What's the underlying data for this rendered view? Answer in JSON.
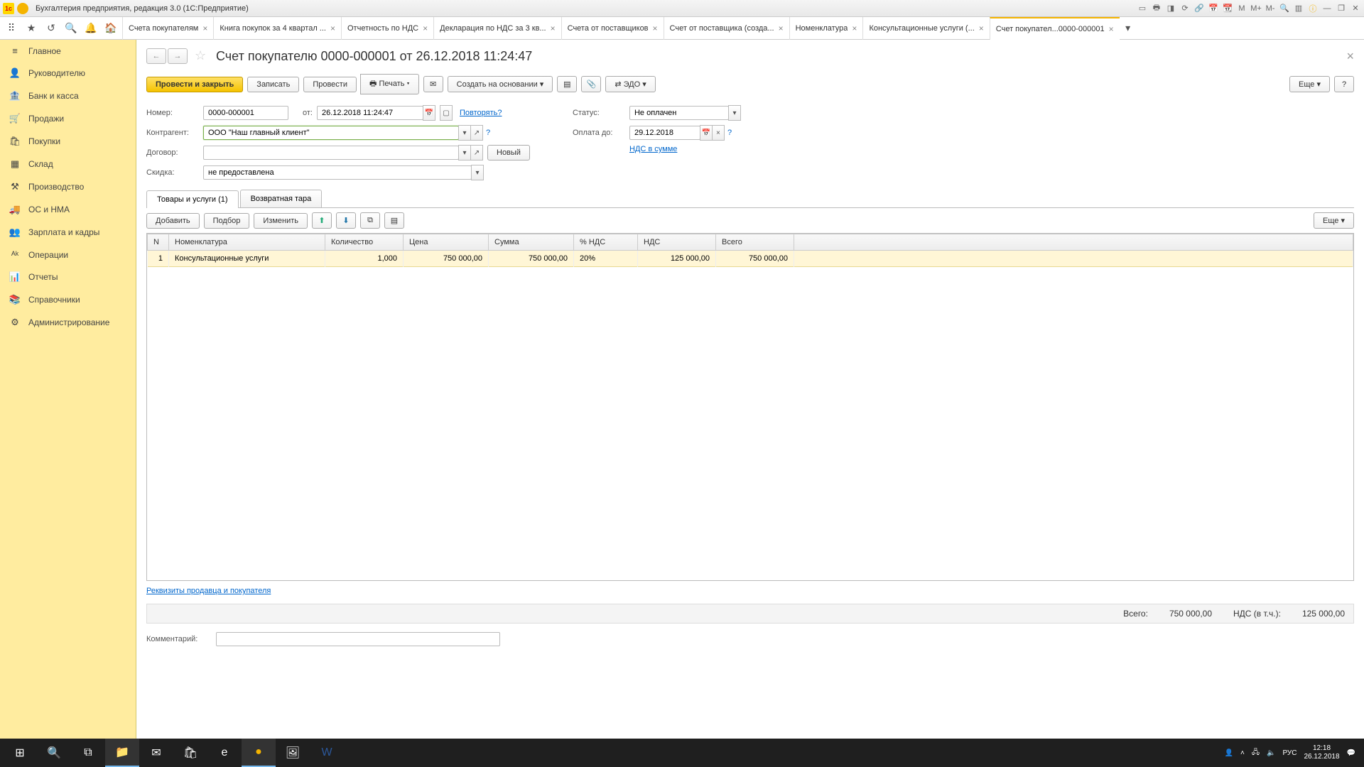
{
  "titlebar": {
    "app_title": "Бухгалтерия предприятия, редакция 3.0  (1С:Предприятие)"
  },
  "tabs": [
    {
      "label": "Счета покупателям"
    },
    {
      "label": "Книга покупок за 4 квартал ..."
    },
    {
      "label": "Отчетность по НДС"
    },
    {
      "label": "Декларация по НДС за 3 кв..."
    },
    {
      "label": "Счета от поставщиков"
    },
    {
      "label": "Счет от поставщика (созда..."
    },
    {
      "label": "Номенклатура"
    },
    {
      "label": "Консультационные услуги (..."
    },
    {
      "label": "Счет покупател...0000-000001",
      "active": true
    }
  ],
  "sidebar": [
    {
      "icon": "≡",
      "label": "Главное"
    },
    {
      "icon": "👤",
      "label": "Руководителю"
    },
    {
      "icon": "🏦",
      "label": "Банк и касса"
    },
    {
      "icon": "🛒",
      "label": "Продажи"
    },
    {
      "icon": "🛍",
      "label": "Покупки"
    },
    {
      "icon": "▦",
      "label": "Склад"
    },
    {
      "icon": "⚒",
      "label": "Производство"
    },
    {
      "icon": "🚚",
      "label": "ОС и НМА"
    },
    {
      "icon": "👥",
      "label": "Зарплата и кадры"
    },
    {
      "icon": "ᴬᵏ",
      "label": "Операции"
    },
    {
      "icon": "📊",
      "label": "Отчеты"
    },
    {
      "icon": "📚",
      "label": "Справочники"
    },
    {
      "icon": "⚙",
      "label": "Администрирование"
    }
  ],
  "doc": {
    "title": "Счет покупателю 0000-000001 от 26.12.2018 11:24:47",
    "buttons": {
      "post_close": "Провести и закрыть",
      "save": "Записать",
      "post": "Провести",
      "print": "Печать",
      "create_based": "Создать на основании",
      "edo": "ЭДО",
      "more": "Еще"
    },
    "labels": {
      "number": "Номер:",
      "date_from": "от:",
      "repeat": "Повторять?",
      "status": "Статус:",
      "counterparty": "Контрагент:",
      "contract": "Договор:",
      "new_btn": "Новый",
      "discount": "Скидка:",
      "pay_until": "Оплата до:",
      "vat_in_sum": "НДС в сумме"
    },
    "fields": {
      "number": "0000-000001",
      "date": "26.12.2018 11:24:47",
      "status": "Не оплачен",
      "counterparty": "ООО \"Наш главный клиент\"",
      "contract": "",
      "discount": "не предоставлена",
      "pay_until": "29.12.2018",
      "comment": ""
    },
    "inner_tabs": {
      "tab1": "Товары и услуги (1)",
      "tab2": "Возвратная тара"
    },
    "grid_toolbar": {
      "add": "Добавить",
      "pick": "Подбор",
      "edit": "Изменить",
      "more": "Еще"
    },
    "columns": {
      "n": "N",
      "nomenclature": "Номенклатура",
      "qty": "Количество",
      "price": "Цена",
      "sum": "Сумма",
      "vat_pct": "% НДС",
      "vat": "НДС",
      "total": "Всего"
    },
    "rows": [
      {
        "n": "1",
        "nomenclature": "Консультационные услуги",
        "qty": "1,000",
        "price": "750 000,00",
        "sum": "750 000,00",
        "vat_pct": "20%",
        "vat": "125 000,00",
        "total": "750 000,00"
      }
    ],
    "footer": {
      "seller_buyer_link": "Реквизиты продавца и покупателя",
      "total_label": "Всего:",
      "total_value": "750 000,00",
      "vat_label": "НДС (в т.ч.):",
      "vat_value": "125 000,00",
      "comment_label": "Комментарий:"
    }
  },
  "taskbar": {
    "time": "12:18",
    "date": "26.12.2018",
    "lang": "РУС"
  }
}
